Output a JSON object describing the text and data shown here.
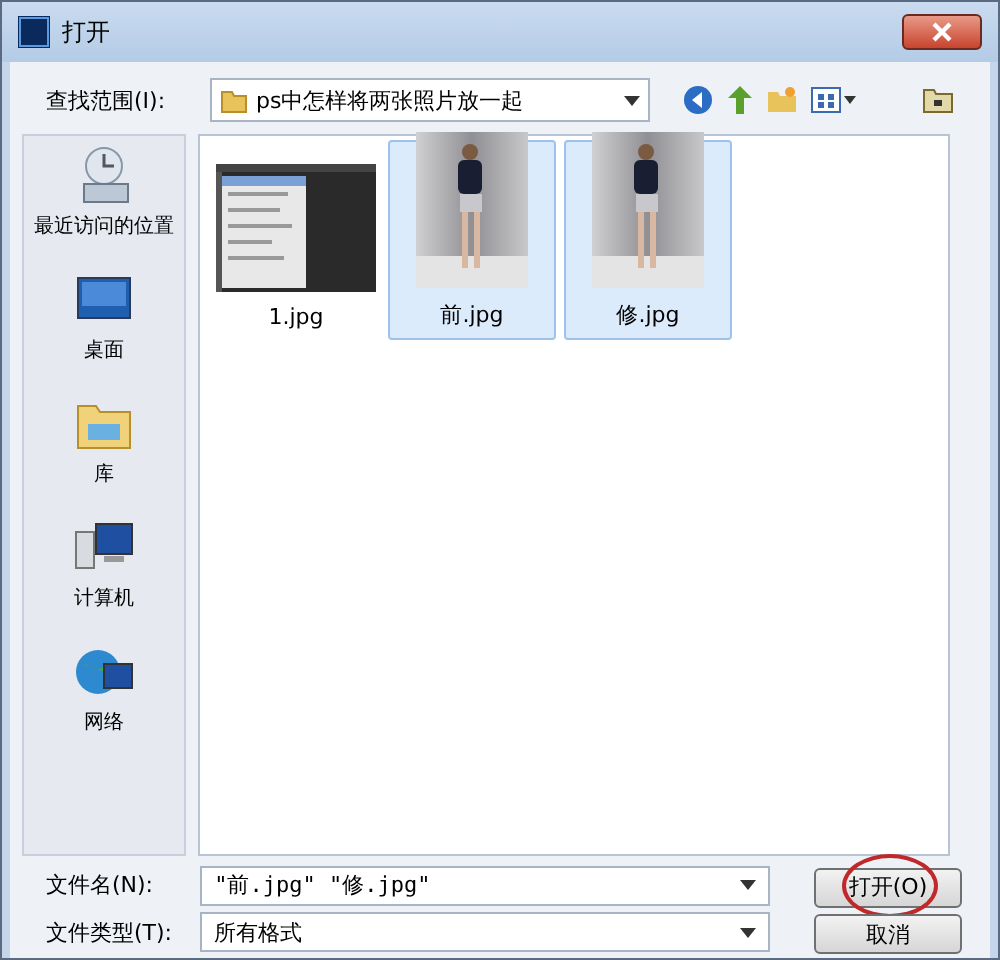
{
  "window": {
    "title": "打开"
  },
  "look_in": {
    "label": "查找范围(I):",
    "value": "ps中怎样将两张照片放一起"
  },
  "places": [
    {
      "label": "最近访问的位置",
      "kind": "recent"
    },
    {
      "label": "桌面",
      "kind": "desktop"
    },
    {
      "label": "库",
      "kind": "library"
    },
    {
      "label": "计算机",
      "kind": "computer"
    },
    {
      "label": "网络",
      "kind": "network"
    }
  ],
  "files": [
    {
      "name": "1.jpg",
      "kind": "screenshot",
      "selected": false
    },
    {
      "name": "前.jpg",
      "selected": true
    },
    {
      "name": "修.jpg",
      "selected": true
    }
  ],
  "file_name": {
    "label": "文件名(N):",
    "value": "\"前.jpg\" \"修.jpg\""
  },
  "file_type": {
    "label": "文件类型(T):",
    "value": "所有格式"
  },
  "buttons": [
    {
      "label": "打开(O)",
      "circled": true
    },
    {
      "label": "取消",
      "circled": false
    }
  ]
}
